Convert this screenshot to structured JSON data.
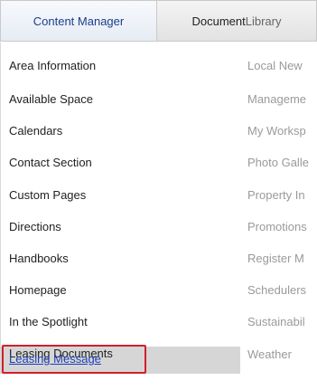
{
  "tabs": {
    "content_manager": "Content Manager",
    "document_library_part1": "Document",
    "document_library_part2": " Library"
  },
  "left_items": [
    "Area Information",
    "Available Space",
    "Calendars",
    "Contact Section",
    "Custom Pages",
    "Directions",
    "Handbooks",
    "Homepage",
    "In the Spotlight",
    "Leasing Documents",
    "Leasing Message"
  ],
  "right_items": [
    "Local New",
    "Manageme",
    "My Worksp",
    "Photo Galle",
    "Property In",
    "Promotions",
    "Register M",
    "Schedulers",
    "Sustainabil",
    "Weather"
  ],
  "colors": {
    "active_link": "#1c3fb5",
    "highlight_border": "#d0202b",
    "highlight_row": "#d6d6d6"
  }
}
